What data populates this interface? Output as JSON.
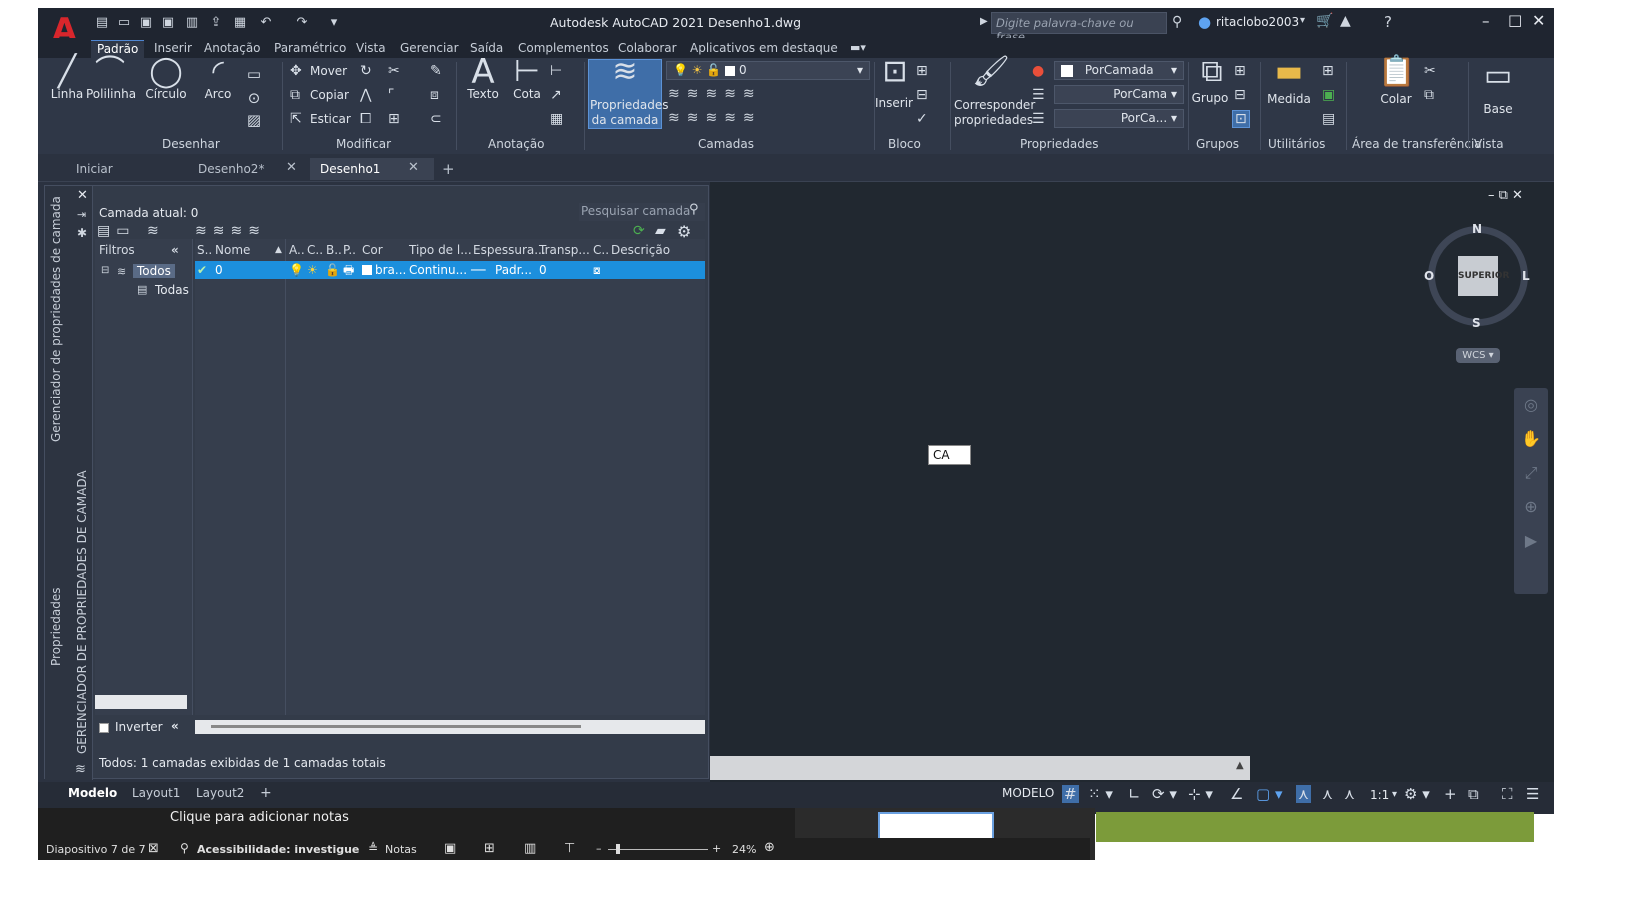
{
  "app": {
    "logo": "A",
    "title": "Autodesk AutoCAD 2021    Desenho1.dwg",
    "search_placeholder": "Digite palavra-chave ou frase",
    "user": "ritaclobo2003"
  },
  "menu": [
    "Padrão",
    "Inserir",
    "Anotação",
    "Paramétrico",
    "Vista",
    "Gerenciar",
    "Saída",
    "Complementos",
    "Colaborar",
    "Aplicativos em destaque"
  ],
  "ribbon": {
    "draw": {
      "linha": "Linha",
      "polilinha": "Polilinha",
      "circulo": "Círculo",
      "arco": "Arco",
      "panel": "Desenhar"
    },
    "modify": {
      "mover": "Mover",
      "copiar": "Copiar",
      "esticar": "Esticar",
      "panel": "Modificar"
    },
    "annotation": {
      "texto": "Texto",
      "cota": "Cota",
      "panel": "Anotação"
    },
    "layers": {
      "prop1": "Propriedades",
      "prop2": "da camada",
      "current": "0",
      "panel": "Camadas"
    },
    "block": {
      "inserir": "Inserir",
      "panel": "Bloco"
    },
    "properties": {
      "corr1": "Corresponder",
      "corr2": "propriedades",
      "color": "PorCamada",
      "linetype": "PorCama",
      "lineweight": "PorCa...",
      "panel": "Propriedades"
    },
    "groups": {
      "grupo": "Grupo",
      "panel": "Grupos"
    },
    "utilities": {
      "medida": "Medida",
      "panel": "Utilitários"
    },
    "clipboard": {
      "colar": "Colar",
      "panel": "Área de transferência"
    },
    "view": {
      "base": "Base",
      "panel": "Vista"
    }
  },
  "doctabs": {
    "iniciar": "Iniciar",
    "d2": "Desenho2*",
    "d1": "Desenho1"
  },
  "palette": {
    "current_layer": "Camada atual: 0",
    "search_placeholder": "Pesquisar camada",
    "filters_header": "Filtros",
    "tree_all": "Todos",
    "tree_child": "Todas",
    "invert": "Inverter",
    "status": "Todos: 1 camadas exibidas de 1 camadas totais",
    "side_title": "Gerenciador de propriedades de camada",
    "side_props": "Propriedades",
    "side_caps": "GERENCIADOR DE PROPRIEDADES DE CAMADA",
    "columns": [
      "S..",
      "Nome",
      "A..",
      "C..",
      "B..",
      "P..",
      "Cor",
      "Tipo de l...",
      "Espessura...",
      "Transp...",
      "C..",
      "Descrição"
    ],
    "row": {
      "name": "0",
      "color": "bra...",
      "linetype": "Continu...",
      "lineweight": "Padr...",
      "transparency": "0"
    }
  },
  "canvas": {
    "input_box": "CA",
    "compass": {
      "n": "N",
      "s": "S",
      "w": "O",
      "e": "L",
      "center": "SUPERIOR",
      "wcs": "WCS"
    }
  },
  "layouts": {
    "modelo": "Modelo",
    "l1": "Layout1",
    "l2": "Layout2"
  },
  "status": {
    "modelo": "MODELO",
    "scale": "1:1"
  },
  "host": {
    "notes": "Clique para adicionar notas",
    "slide": "Diapositivo 7 de 7",
    "access": "Acessibilidade: investigue",
    "notas": "Notas",
    "zoom": "24%"
  }
}
